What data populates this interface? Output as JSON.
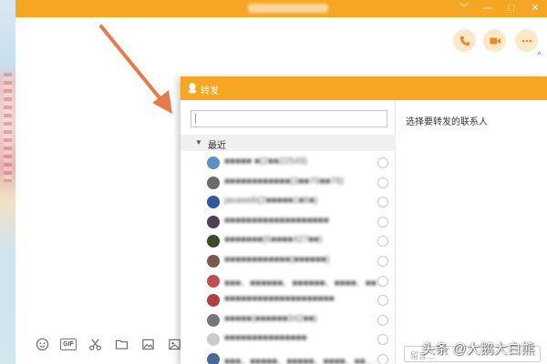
{
  "chat": {
    "title": "",
    "window_controls": [
      "﹀",
      "—",
      "□",
      "✕"
    ],
    "actions": [
      {
        "name": "phone-call-button",
        "icon": "phone-icon"
      },
      {
        "name": "video-call-button",
        "icon": "video-camera-icon"
      },
      {
        "name": "more-button",
        "icon": "more-dots-icon"
      }
    ],
    "collapse_glyph": "^",
    "toolbar": [
      {
        "name": "emoji-button",
        "icon": "smiley-icon"
      },
      {
        "name": "gif-button",
        "icon": "gif-icon",
        "label": "GIF"
      },
      {
        "name": "screenshot-button",
        "icon": "scissors-icon"
      },
      {
        "name": "file-button",
        "icon": "folder-icon"
      },
      {
        "name": "image-button",
        "icon": "picture-icon"
      },
      {
        "name": "photo-button",
        "icon": "image-icon"
      },
      {
        "name": "phone-button",
        "icon": "mobile-icon"
      }
    ]
  },
  "dialog": {
    "title": "转发",
    "search_placeholder": "",
    "section_label": "最近",
    "section_caret": "▼",
    "right_hint": "选择要转发的联系人",
    "bottom_placeholder": "留言…",
    "contacts": [
      {
        "name": "■■■■■ ■(2■■22549)",
        "avatar_color": "#5a8fc7"
      },
      {
        "name": "■■■■■■■■■■■■(3■■79■■78)",
        "avatar_color": "#6a6a6a"
      },
      {
        "name": "javaweb(2■■■■■1■8■)",
        "avatar_color": "#2d5a9e"
      },
      {
        "name": "■■■■■■■■■■■■■■■■■■■",
        "avatar_color": "#4b3f5a"
      },
      {
        "name": "■■■■■■■(6■■■■427■■)",
        "avatar_color": "#3a4a2a"
      },
      {
        "name": "■■■■■■■■■■■■(■■■■■■)",
        "avatar_color": "#7a5a4a"
      },
      {
        "name": "■■■、■■■■■■、■■■■■■、■■■■、■■...",
        "avatar_color": "#c05050"
      },
      {
        "name": "■■■■■■■■■■■■■■■■■■■■",
        "avatar_color": "#b04040"
      },
      {
        "name": "■■■■■(■■■■■■342■■)",
        "avatar_color": "#777777"
      },
      {
        "name": "■■■■■■■■■■■■■■■",
        "avatar_color": "#cccccc"
      },
      {
        "name": "■■■、■■■■■、■■■■■、■■■■、■■...",
        "avatar_color": "#4a6a9a"
      }
    ]
  },
  "watermark": "头条 @大鹅大白熊",
  "colors": {
    "accent": "#f5a623",
    "action_bg": "#fde8c9",
    "arrow": "#e87a4a"
  }
}
